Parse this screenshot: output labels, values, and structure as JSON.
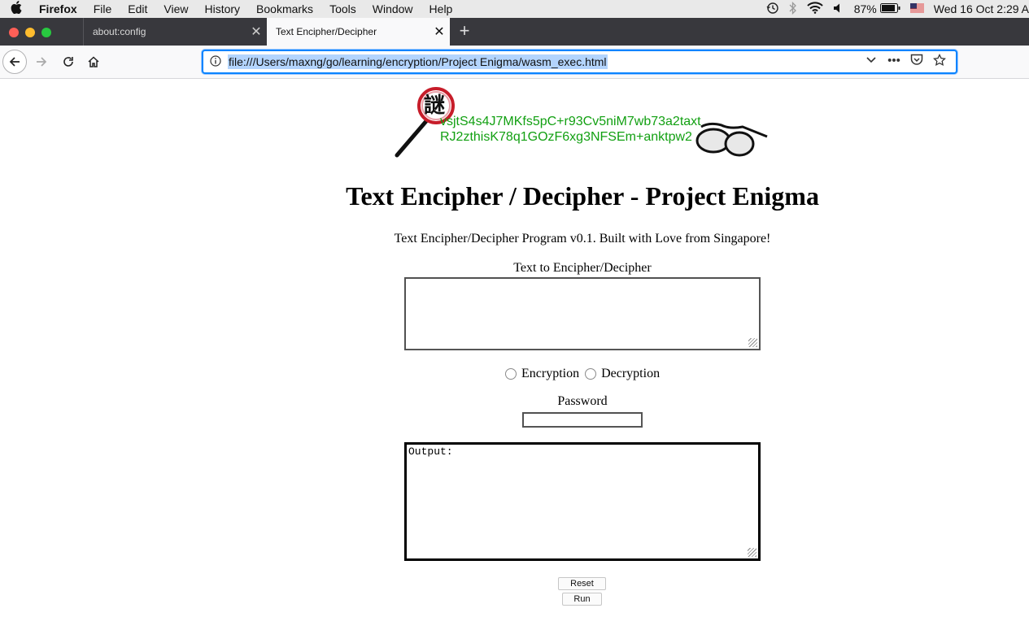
{
  "menubar": {
    "app_name": "Firefox",
    "items": [
      "File",
      "Edit",
      "View",
      "History",
      "Bookmarks",
      "Tools",
      "Window",
      "Help"
    ],
    "battery": "87%",
    "clock": "Wed 16 Oct  2:29 A"
  },
  "tabs": [
    {
      "title": "about:config",
      "active": false
    },
    {
      "title": "Text Encipher/Decipher",
      "active": true
    }
  ],
  "navbar": {
    "url": "file:///Users/maxng/go/learning/encryption/Project Enigma/wasm_exec.html"
  },
  "page": {
    "logo_glyph": "謎",
    "logo_text_line1": "vsjtS4s4J7MKfs5pC+r93Cv5niM7wb73a2taxt",
    "logo_text_line2": "RJ2zthisK78q1GOzF6xg3NFSEm+anktpw2",
    "title": "Text Encipher / Decipher - Project Enigma",
    "subtitle": "Text Encipher/Decipher Program v0.1. Built with Love from Singapore!",
    "input_label": "Text to Encipher/Decipher",
    "input_value": "",
    "radio_encryption": "Encryption",
    "radio_decryption": "Decryption",
    "password_label": "Password",
    "password_value": "",
    "output_value": "Output:",
    "reset_button": "Reset",
    "run_button": "Run"
  },
  "colors": {
    "logo_text": "#12a012",
    "url_highlight": "#b3d4fd",
    "tabstrip": "#38383d"
  }
}
